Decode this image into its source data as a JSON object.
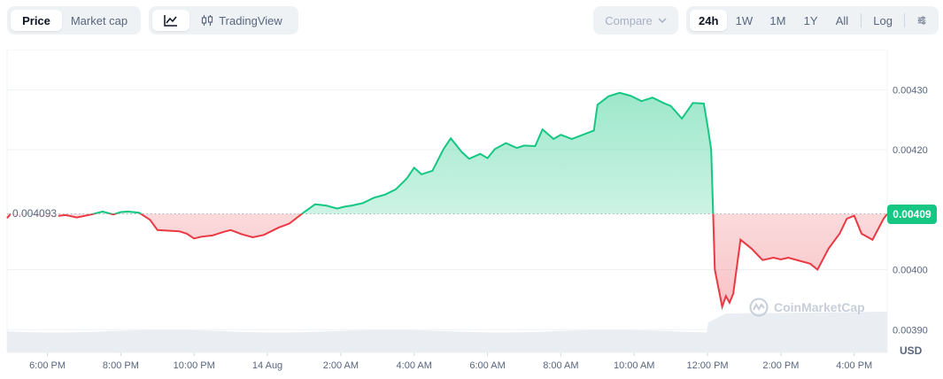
{
  "toolbar": {
    "view_tabs": [
      "Price",
      "Market cap"
    ],
    "active_view": "Price",
    "chart_mode_line_icon": "line-chart-icon",
    "tradingview_label": "TradingView",
    "compare_label": "Compare",
    "ranges": [
      "24h",
      "1W",
      "1M",
      "1Y",
      "All"
    ],
    "active_range": "24h",
    "log_label": "Log",
    "settings_icon": "sliders-icon"
  },
  "current_price_label": "0.00409",
  "reference_price_label": "0.004093",
  "currency_label": "USD",
  "watermark": "CoinMarketCap",
  "colors": {
    "up": "#16c784",
    "down": "#ea3943",
    "ref_line": "#a6b0c3",
    "tag_bg": "#16c784"
  },
  "chart_data": {
    "type": "area",
    "baseline": 0.004093,
    "ylim": [
      0.003862,
      0.004367
    ],
    "yticks": [
      0.0043,
      0.0042,
      0.004,
      0.0039
    ],
    "ytick_labels": [
      "0.00430",
      "0.00420",
      "0.00400",
      "0.00390"
    ],
    "xticks": [
      2,
      4,
      6,
      8,
      10,
      12,
      14,
      16,
      18,
      20,
      22,
      24
    ],
    "xtick_labels": [
      "6:00 PM",
      "8:00 PM",
      "10:00 PM",
      "14 Aug",
      "2:00 AM",
      "4:00 AM",
      "6:00 AM",
      "8:00 AM",
      "10:00 AM",
      "12:00 PM",
      "2:00 PM",
      "4:00 PM"
    ],
    "xlim": [
      0.9,
      24.9
    ],
    "series": [
      {
        "x": [
          0.9,
          1.0,
          1.2,
          1.5,
          1.8,
          2.0,
          2.2,
          2.5,
          2.8,
          3.2,
          3.5,
          3.8,
          4.0,
          4.2,
          4.5,
          4.8,
          5.0,
          5.3,
          5.6,
          5.8,
          6.0,
          6.2,
          6.5,
          6.8,
          7.0,
          7.3,
          7.6,
          7.9,
          8.1,
          8.3,
          8.6,
          9.0,
          9.3,
          9.6,
          9.9,
          10.1,
          10.3,
          10.6,
          10.9,
          11.2,
          11.5,
          11.8,
          12.0,
          12.2,
          12.5,
          12.8,
          13.0,
          13.3,
          13.5,
          13.8,
          14.0,
          14.2,
          14.5,
          14.8,
          15.0,
          15.3,
          15.5,
          15.8,
          16.0,
          16.3,
          16.6,
          16.9,
          17.0,
          17.3,
          17.6,
          17.9,
          18.2,
          18.5,
          18.8,
          19.0,
          19.3,
          19.6,
          19.9,
          20.0,
          20.1,
          20.2,
          20.4,
          20.5,
          20.6,
          20.7,
          20.9,
          21.2,
          21.5,
          21.8,
          22.0,
          22.2,
          22.5,
          22.8,
          23.0,
          23.3,
          23.6,
          23.8,
          24.0,
          24.2,
          24.5,
          24.8,
          24.9
        ],
        "y": [
          0.004086,
          0.004093,
          0.004091,
          0.004094,
          0.00409,
          0.00409,
          0.004089,
          0.004091,
          0.004087,
          0.004092,
          0.004097,
          0.004092,
          0.004096,
          0.004097,
          0.004095,
          0.004083,
          0.004066,
          0.004065,
          0.004064,
          0.00406,
          0.004052,
          0.004055,
          0.004057,
          0.004063,
          0.004066,
          0.004059,
          0.004054,
          0.004058,
          0.004064,
          0.00407,
          0.004077,
          0.004096,
          0.004109,
          0.004107,
          0.004102,
          0.004105,
          0.004107,
          0.004111,
          0.00412,
          0.004125,
          0.004134,
          0.004152,
          0.00417,
          0.004159,
          0.004165,
          0.004201,
          0.004219,
          0.004196,
          0.004185,
          0.004193,
          0.004186,
          0.004201,
          0.004211,
          0.004203,
          0.004207,
          0.004206,
          0.004234,
          0.004218,
          0.004225,
          0.004218,
          0.004225,
          0.004232,
          0.004275,
          0.004289,
          0.004295,
          0.00429,
          0.004281,
          0.004287,
          0.004278,
          0.004273,
          0.004252,
          0.004278,
          0.004277,
          0.00424,
          0.0042,
          0.004,
          0.003938,
          0.003956,
          0.003945,
          0.00396,
          0.00405,
          0.004035,
          0.004016,
          0.00402,
          0.004017,
          0.00402,
          0.004015,
          0.00401,
          0.004,
          0.004035,
          0.00406,
          0.004085,
          0.00409,
          0.00406,
          0.00405,
          0.004085,
          0.004093
        ]
      }
    ]
  }
}
